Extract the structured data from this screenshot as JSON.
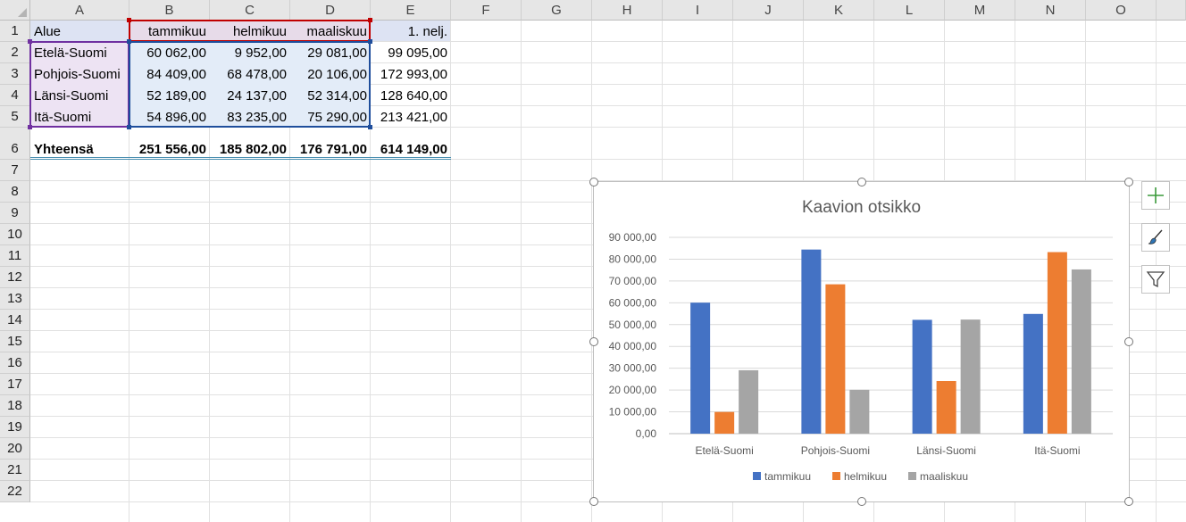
{
  "columns": [
    "A",
    "B",
    "C",
    "D",
    "E",
    "F",
    "G",
    "H",
    "I",
    "J",
    "K",
    "L",
    "M",
    "N",
    "O"
  ],
  "rows": [
    "1",
    "2",
    "3",
    "4",
    "5",
    "6",
    "7",
    "8",
    "9",
    "10",
    "11",
    "12",
    "13",
    "14",
    "15",
    "16",
    "17",
    "18",
    "19",
    "20",
    "21",
    "22"
  ],
  "table": {
    "header": [
      "Alue",
      "tammikuu",
      "helmikuu",
      "maaliskuu",
      "1. nelj."
    ],
    "data": [
      [
        "Etelä-Suomi",
        "60 062,00",
        "9 952,00",
        "29 081,00",
        "99 095,00"
      ],
      [
        "Pohjois-Suomi",
        "84 409,00",
        "68 478,00",
        "20 106,00",
        "172 993,00"
      ],
      [
        "Länsi-Suomi",
        "52 189,00",
        "24 137,00",
        "52 314,00",
        "128 640,00"
      ],
      [
        "Itä-Suomi",
        "54 896,00",
        "83 235,00",
        "75 290,00",
        "213 421,00"
      ]
    ],
    "total": [
      "Yhteensä",
      "251 556,00",
      "185 802,00",
      "176 791,00",
      "614 149,00"
    ]
  },
  "colors": {
    "series": [
      "#4472c4",
      "#ed7d31",
      "#a5a5a5"
    ],
    "range_purple": "#7030a0",
    "range_red": "#c00000",
    "range_blue": "#1f4e9c",
    "fill_header": "#dde3f3",
    "fill_purple": "#ede3f3",
    "fill_blue": "#e3ecf8",
    "fill_header_mid": "#e7dbe9"
  },
  "chart_data": {
    "type": "bar",
    "title": "Kaavion otsikko",
    "categories": [
      "Etelä-Suomi",
      "Pohjois-Suomi",
      "Länsi-Suomi",
      "Itä-Suomi"
    ],
    "series": [
      {
        "name": "tammikuu",
        "values": [
          60062,
          84409,
          52189,
          54896
        ]
      },
      {
        "name": "helmikuu",
        "values": [
          9952,
          68478,
          24137,
          83235
        ]
      },
      {
        "name": "maaliskuu",
        "values": [
          29081,
          20106,
          52314,
          75290
        ]
      }
    ],
    "ylim": [
      0,
      90000
    ],
    "yticks": [
      0,
      10000,
      20000,
      30000,
      40000,
      50000,
      60000,
      70000,
      80000,
      90000
    ],
    "ytick_labels": [
      "0,00",
      "10 000,00",
      "20 000,00",
      "30 000,00",
      "40 000,00",
      "50 000,00",
      "60 000,00",
      "70 000,00",
      "80 000,00",
      "90 000,00"
    ],
    "grid": true,
    "legend": "bottom"
  },
  "side_buttons": {
    "add": "plus-icon",
    "style": "brush-icon",
    "filter": "funnel-icon"
  }
}
